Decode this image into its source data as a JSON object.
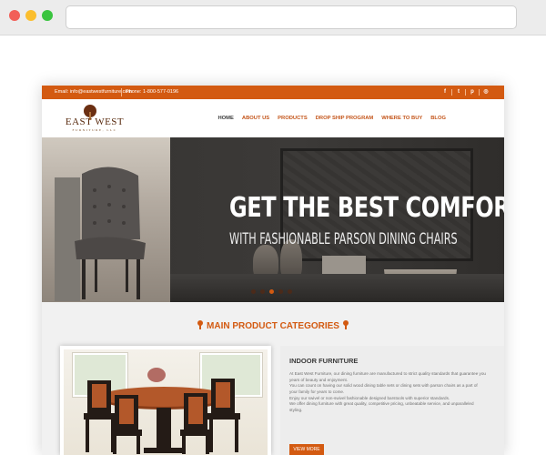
{
  "colors": {
    "brand_orange": "#d35a11",
    "hero_dark": "#3c3a38",
    "section_bg": "#f1f1f1"
  },
  "topbar": {
    "email": "Email: info@eastwestfurniture.com",
    "phone": "Phone: 1-800-577-0196",
    "social": [
      "facebook-icon",
      "twitter-icon",
      "pinterest-icon",
      "instagram-icon"
    ],
    "social_glyphs": [
      "f",
      "t",
      "p",
      "◎"
    ]
  },
  "logo": {
    "name": "EAST WEST",
    "tagline": "FURNITURE, LLC"
  },
  "nav": [
    "HOME",
    "ABOUT US",
    "PRODUCTS",
    "DROP SHIP PROGRAM",
    "WHERE TO BUY",
    "BLOG"
  ],
  "hero": {
    "title": "GET THE BEST COMFORT",
    "subtitle": "WITH FASHIONABLE PARSON DINING CHAIRS",
    "slide_count": 5,
    "active_slide": 3
  },
  "categories": {
    "heading": "MAIN PRODUCT CATEGORIES",
    "items": [
      {
        "title": "INDOOR FURNITURE",
        "description": [
          "At East West Furniture, our dining furniture are manufactured to strict quality standards that guarantee you years of beauty and enjoyment.",
          "You can count on having our solid wood dining table sets or dining sets with parson chairs as a part of your family for years to come.",
          "Enjoy our swivel or non-swivel fashionable designed barstools with superior standards.",
          "We offer dining furniture with great quality, competitive pricing, unbeatable service, and unparalleled styling."
        ],
        "button": "VIEW MORE"
      }
    ]
  }
}
